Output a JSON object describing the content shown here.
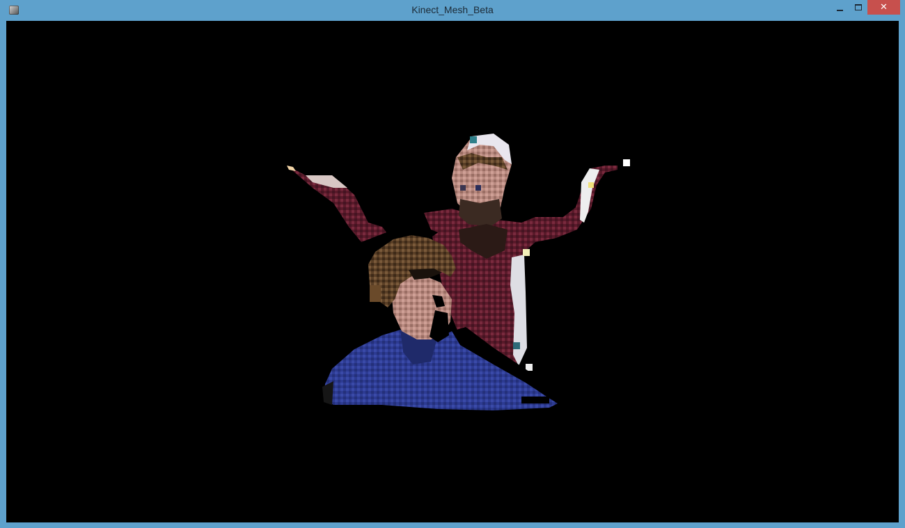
{
  "window": {
    "title": "Kinect_Mesh_Beta",
    "icon": "app-icon",
    "controls": {
      "minimize_icon": "minimize-icon",
      "maximize_icon": "maximize-icon",
      "close_label": "✕"
    }
  },
  "viewport": {
    "background": "#000000",
    "content": "kinect point-cloud mesh"
  },
  "colors": {
    "titlebar": "#5ea1cc",
    "close_button": "#c7504d",
    "border": "#5ea1cc"
  }
}
